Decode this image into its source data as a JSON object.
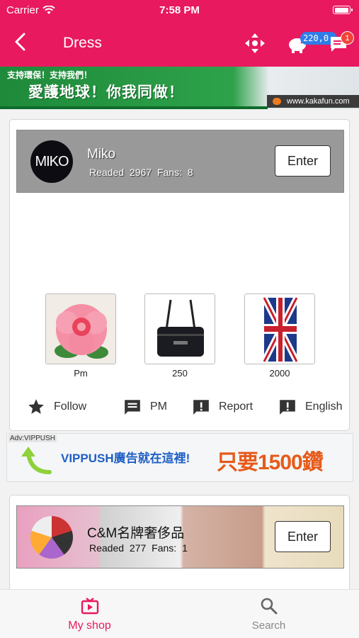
{
  "status_bar": {
    "carrier": "Carrier",
    "time": "7:58 PM"
  },
  "nav": {
    "title": "Dress",
    "coin_badge": "220,0",
    "chat_badge": "1"
  },
  "top_banner": {
    "line1": "支持環保！支持我們！",
    "line2": "愛護地球！你我同做！",
    "url": "www.kakafun.com"
  },
  "shops": [
    {
      "avatar_text": "MIKO",
      "name": "Miko",
      "stats": "Readed 2967  Fans: 8",
      "enter_label": "Enter",
      "products": [
        {
          "price": "Pm",
          "image": "pink-flower-pillow"
        },
        {
          "price": "250",
          "image": "black-shoulder-bag"
        },
        {
          "price": "2000",
          "image": "union-jack-umbrella"
        }
      ],
      "actions": [
        {
          "label": "Follow",
          "icon": "star-icon"
        },
        {
          "label": "PM",
          "icon": "message-icon"
        },
        {
          "label": "Report",
          "icon": "report-icon"
        },
        {
          "label": "English",
          "icon": "report-icon"
        }
      ]
    },
    {
      "name": "C&M名牌奢侈品",
      "stats": "Readed 277   Fans: 1",
      "enter_label": "Enter"
    }
  ],
  "mid_ad": {
    "tag": "Adv:VIPPUSH",
    "text1": "VIPPUSH廣告就在這裡!",
    "text2": "只要1500鑽"
  },
  "tabbar": {
    "my_shop": "My shop",
    "search": "Search"
  },
  "colors": {
    "accent": "#e8195f",
    "badge_blue": "#2f7ce8",
    "badge_red": "#f04438"
  }
}
